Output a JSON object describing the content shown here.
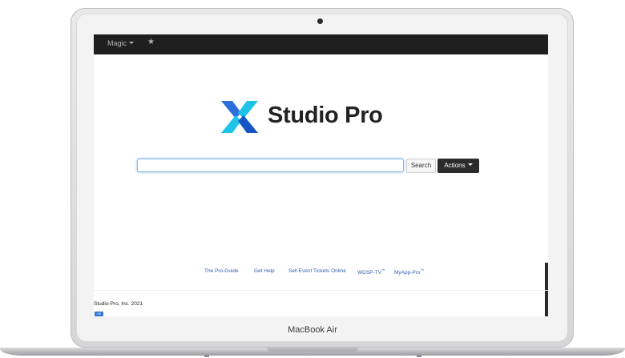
{
  "device": {
    "label": "MacBook Air"
  },
  "navbar": {
    "menu_label": "Magic",
    "favorites_icon": "star-icon"
  },
  "logo": {
    "text": "Studio Pro",
    "colors": [
      "#2a6fdb",
      "#1ec3e8",
      "#1556c4"
    ]
  },
  "search": {
    "value": "",
    "placeholder": "",
    "search_label": "Search",
    "actions_label": "Actions"
  },
  "footer": {
    "links": [
      {
        "label": "The Pro-Guide",
        "sup": ""
      },
      {
        "label": "Get Help",
        "sup": ""
      },
      {
        "label": "Sell Event Tickets Online",
        "sup": ""
      },
      {
        "label": "WDSP-TV",
        "sup": "™"
      },
      {
        "label": "MyApp-Pro",
        "sup": "™"
      }
    ],
    "copyright": "Studio-Pro, Inc. 2021",
    "badge": "OK"
  },
  "colors": {
    "navbar_bg": "#1f1f1f",
    "link": "#2f5fb3",
    "focus_ring": "#86b7e3"
  }
}
